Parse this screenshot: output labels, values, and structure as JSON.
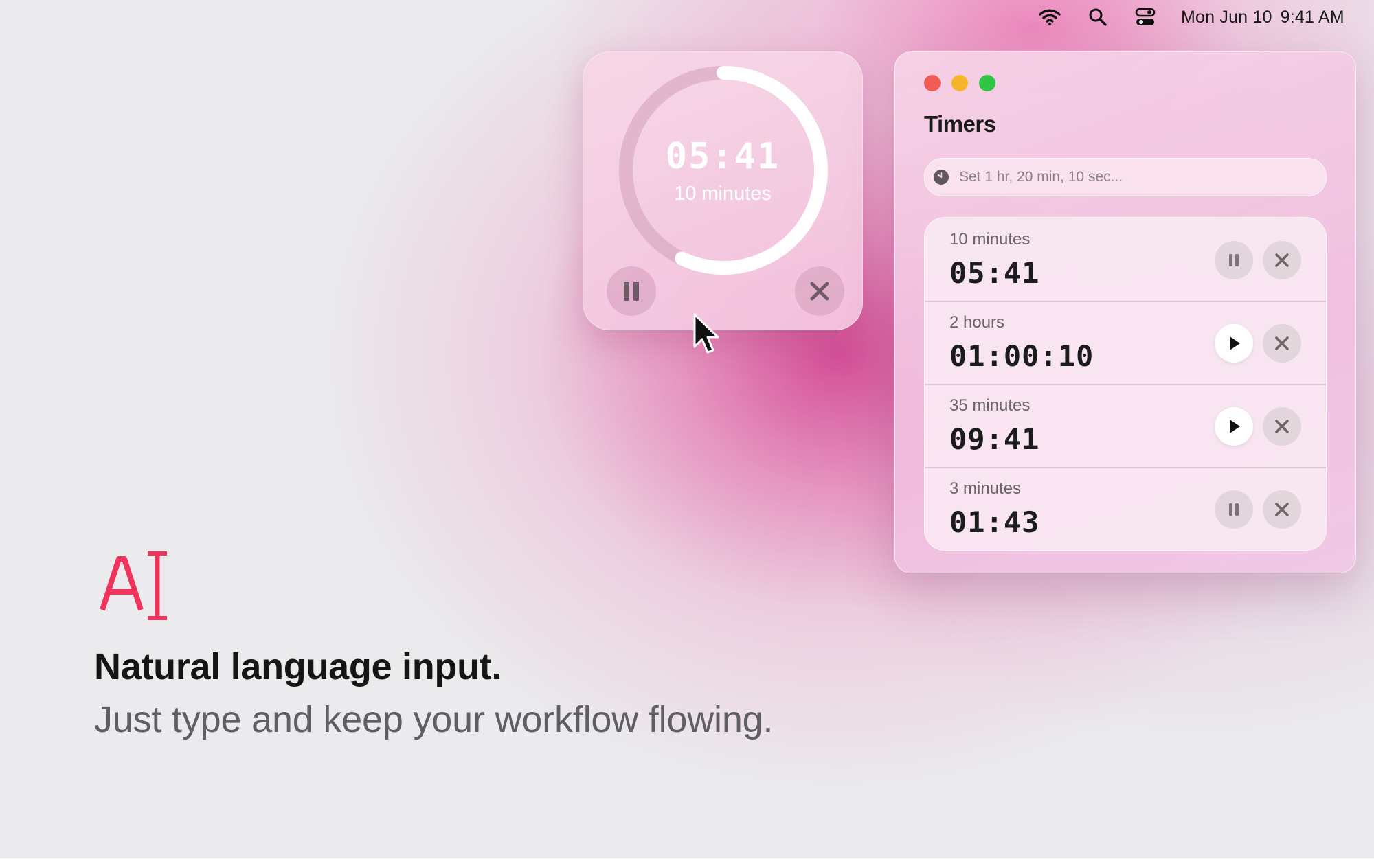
{
  "menubar": {
    "icons": [
      "wifi-icon",
      "search-icon",
      "control-center-icon"
    ],
    "date": "Mon Jun 10",
    "time": "9:41 AM"
  },
  "widget": {
    "time": "05:41",
    "label": "10 minutes",
    "progress": 0.57,
    "left_button_icon": "pause-icon",
    "right_button_icon": "close-icon"
  },
  "window": {
    "title": "Timers",
    "search": {
      "placeholder": "Set 1 hr, 20 min, 10 sec...",
      "value": ""
    },
    "timers": [
      {
        "name": "10 minutes",
        "time": "05:41",
        "state": "running",
        "control_icon": "pause-icon"
      },
      {
        "name": "2 hours",
        "time": "01:00:10",
        "state": "paused",
        "control_icon": "play-icon"
      },
      {
        "name": "35 minutes",
        "time": "09:41",
        "state": "paused",
        "control_icon": "play-icon"
      },
      {
        "name": "3 minutes",
        "time": "01:43",
        "state": "running",
        "control_icon": "pause-icon"
      }
    ]
  },
  "promo": {
    "icon": "text-cursor-icon",
    "headline": "Natural language input.",
    "subline": "Just type and keep your workflow flowing."
  },
  "colors": {
    "accent": "#f0345c",
    "traffic_red": "#f25a55",
    "traffic_yellow": "#f7b62a",
    "traffic_green": "#2fc545"
  }
}
